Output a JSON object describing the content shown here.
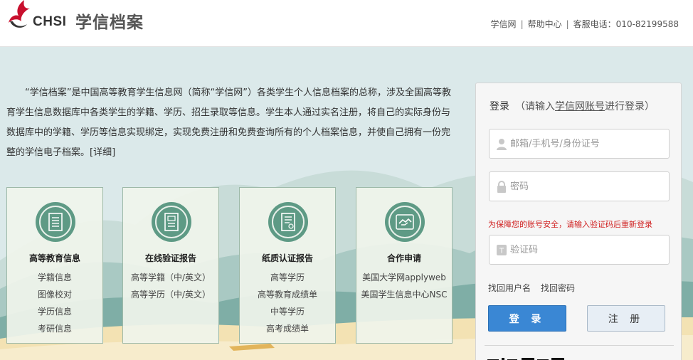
{
  "header": {
    "logo_text": "CHSI",
    "site_title": "学信档案",
    "links": [
      "学信网",
      "帮助中心"
    ],
    "hotline": "客服电话：010-82199588"
  },
  "intro": {
    "text": "“学信档案”是中国高等教育学生信息网（简称“学信网”）各类学生个人信息档案的总称，涉及全国高等教育学生信息数据库中各类学生的学籍、学历、招生录取等信息。学生本人通过实名注册，将自己的实际身份与数据库中的学籍、学历等信息实现绑定，实现免费注册和免费查询所有的个人档案信息，并使自己拥有一份完整的学信电子档案。",
    "detail_link": "[详细]"
  },
  "cards": [
    {
      "title": "高等教育信息",
      "icon": "document-list-icon",
      "items": [
        "学籍信息",
        "图像校对",
        "学历信息",
        "考研信息"
      ]
    },
    {
      "title": "在线验证报告",
      "icon": "certificate-icon",
      "items": [
        "高等学籍（中/英文）",
        "高等学历（中/英文）"
      ]
    },
    {
      "title": "纸质认证报告",
      "icon": "paper-report-icon",
      "items": [
        "高等学历",
        "高等教育成绩单",
        "中等学历",
        "高考成绩单"
      ]
    },
    {
      "title": "合作申请",
      "icon": "handshake-icon",
      "items": [
        "美国大学网applyweb",
        "美国学生信息中心NSC"
      ]
    }
  ],
  "login": {
    "title": "登录",
    "hint_prefix": "（请输入",
    "hint_link": "学信网账号",
    "hint_suffix": "进行登录）",
    "username_placeholder": "邮箱/手机号/身份证号",
    "password_placeholder": "密码",
    "warning": "为保障您的账号安全，请输入验证码后重新登录",
    "captcha_placeholder": "验证码",
    "find_username": "找回用户名",
    "find_password": "找回密码",
    "login_button": "登 录",
    "register_button": "注 册"
  },
  "colors": {
    "accent_blue": "#3a87d4",
    "brand_red": "#c8102e",
    "warning_red": "#d02020",
    "icon_green": "#5e9a85"
  }
}
